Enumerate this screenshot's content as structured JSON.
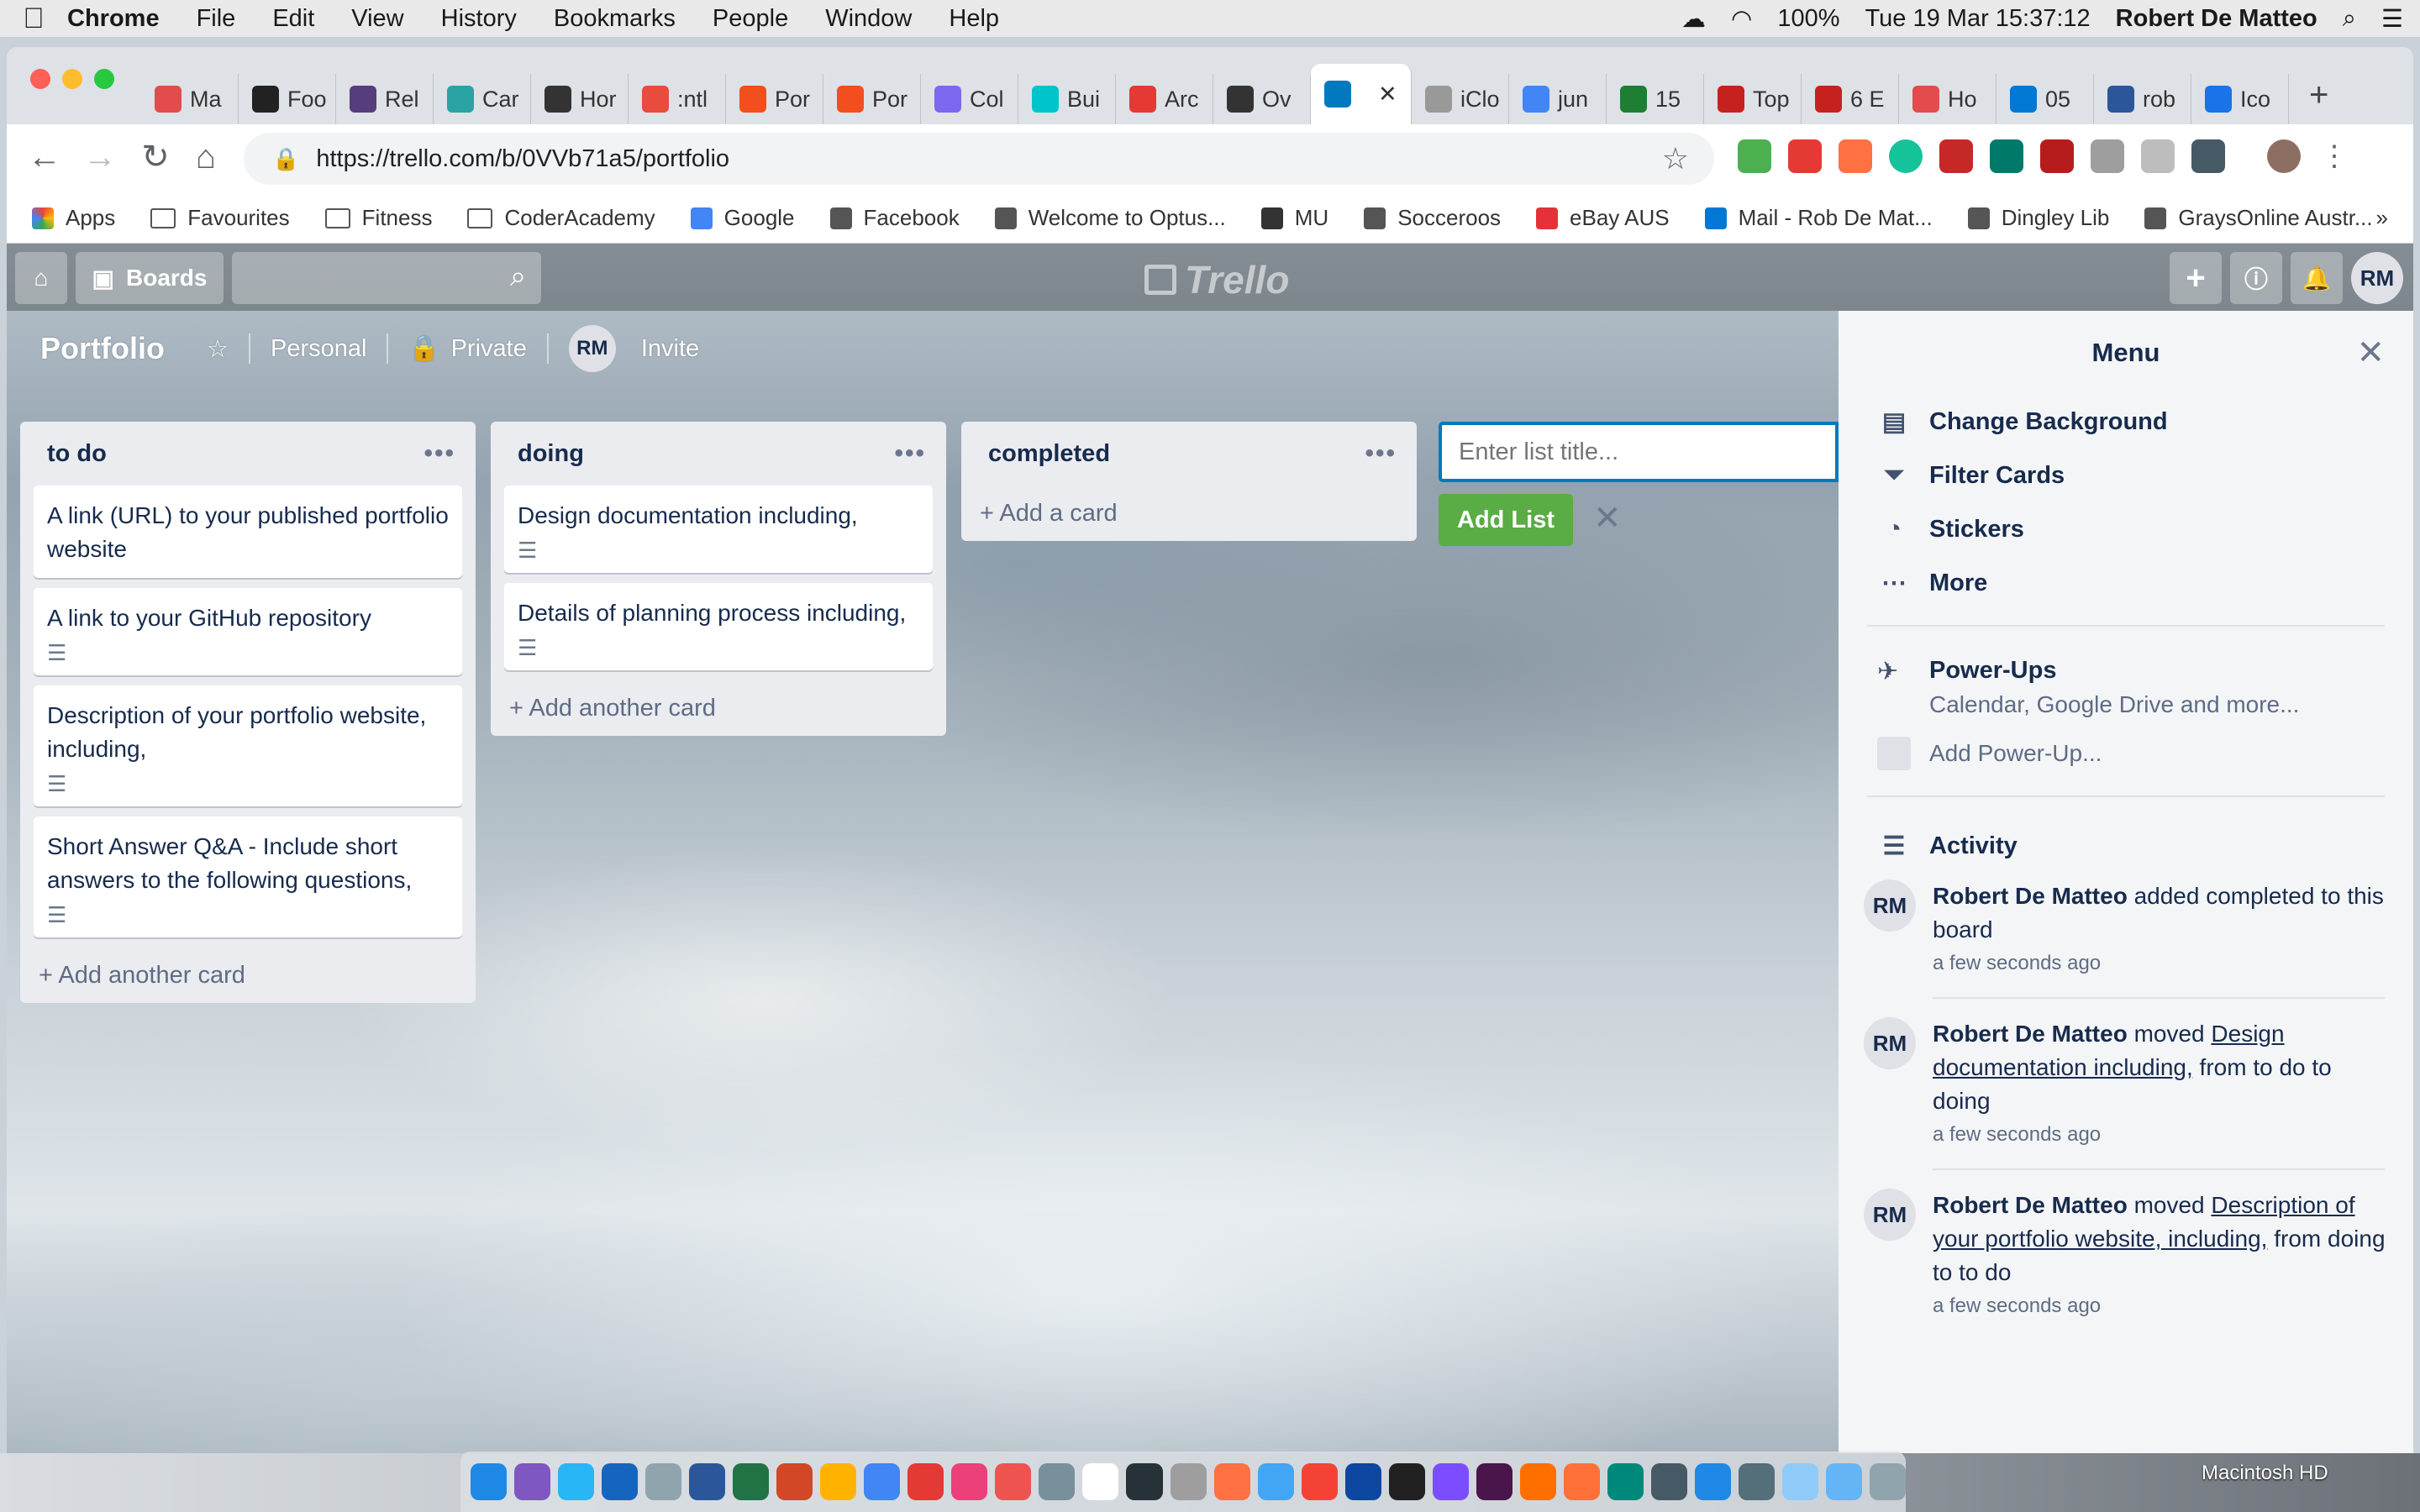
{
  "menubar": {
    "app": "Chrome",
    "items": [
      "File",
      "Edit",
      "View",
      "History",
      "Bookmarks",
      "People",
      "Window",
      "Help"
    ],
    "battery": "100%",
    "datetime": "Tue 19 Mar  15:37:12",
    "user": "Robert De Matteo"
  },
  "tabs": [
    {
      "label": "Ma",
      "color": "#e34c4c"
    },
    {
      "label": "Foo",
      "color": "#222"
    },
    {
      "label": "Rel",
      "color": "#563d7c"
    },
    {
      "label": "Car",
      "color": "#2aa3a3"
    },
    {
      "label": "Hor",
      "color": "#333"
    },
    {
      "label": ":ntl",
      "color": "#e84c3d"
    },
    {
      "label": "Por",
      "color": "#f24e1e"
    },
    {
      "label": "Por",
      "color": "#f24e1e"
    },
    {
      "label": "Col",
      "color": "#7b68ee"
    },
    {
      "label": "Bui",
      "color": "#00c4cc"
    },
    {
      "label": "Arc",
      "color": "#e53935"
    },
    {
      "label": "Ov",
      "color": "#333"
    },
    {
      "label": "",
      "color": "#0079bf",
      "active": true
    },
    {
      "label": "iClo",
      "color": "#999"
    },
    {
      "label": "jun",
      "color": "#4285f4"
    },
    {
      "label": "15",
      "color": "#1e7e34"
    },
    {
      "label": "Top",
      "color": "#c5221f"
    },
    {
      "label": "6 E",
      "color": "#c5221f"
    },
    {
      "label": "Ho",
      "color": "#e34c4c"
    },
    {
      "label": "05",
      "color": "#0078d4"
    },
    {
      "label": "rob",
      "color": "#2b579a"
    },
    {
      "label": "Ico",
      "color": "#1a73e8"
    }
  ],
  "url": "https://trello.com/b/0VVb71a5/portfolio",
  "bookmarks": [
    "Apps",
    "Favourites",
    "Fitness",
    "CoderAcademy",
    "Google",
    "Facebook",
    "Welcome to Optus...",
    "MU",
    "Socceroos",
    "eBay AUS",
    "Mail - Rob De Mat...",
    "Dingley Lib",
    "GraysOnline Austr..."
  ],
  "bookmarks_more": "»",
  "header": {
    "boards": "Boards",
    "logo": "Trello",
    "avatar": "RM"
  },
  "board": {
    "name": "Portfolio",
    "team": "Personal",
    "visibility": "Private",
    "member": "RM",
    "invite": "Invite"
  },
  "lists": [
    {
      "title": "to do",
      "cards": [
        {
          "text": "A link (URL) to your published portfolio website",
          "desc": false
        },
        {
          "text": "A link to your GitHub repository",
          "desc": true
        },
        {
          "text": "Description of your portfolio website, including,",
          "desc": true
        },
        {
          "text": "Short Answer Q&A - Include short answers to the following questions,",
          "desc": true
        }
      ],
      "add": "+ Add another card"
    },
    {
      "title": "doing",
      "cards": [
        {
          "text": "Design documentation including,",
          "desc": true
        },
        {
          "text": "Details of planning process including,",
          "desc": true
        }
      ],
      "add": "+ Add another card"
    },
    {
      "title": "completed",
      "cards": [],
      "add": "+ Add a card"
    }
  ],
  "addlist": {
    "placeholder": "Enter list title...",
    "button": "Add List"
  },
  "menu": {
    "title": "Menu",
    "items": [
      "Change Background",
      "Filter Cards",
      "Stickers",
      "More"
    ],
    "powerups_title": "Power-Ups",
    "powerups_sub": "Calendar, Google Drive and more...",
    "add_powerup": "Add Power-Up...",
    "activity_title": "Activity",
    "activity": [
      {
        "who": "Robert De Matteo",
        "pre": " added completed to this board",
        "link": "",
        "post": "",
        "time": "a few seconds ago"
      },
      {
        "who": "Robert De Matteo",
        "pre": " moved ",
        "link": "Design documentation including,",
        "post": " from to do to doing",
        "time": "a few seconds ago"
      },
      {
        "who": "Robert De Matteo",
        "pre": " moved ",
        "link": "Description of your portfolio website, including,",
        "post": " from doing to to do",
        "time": "a few seconds ago"
      }
    ]
  },
  "dock": {
    "hd": "Macintosh HD"
  }
}
